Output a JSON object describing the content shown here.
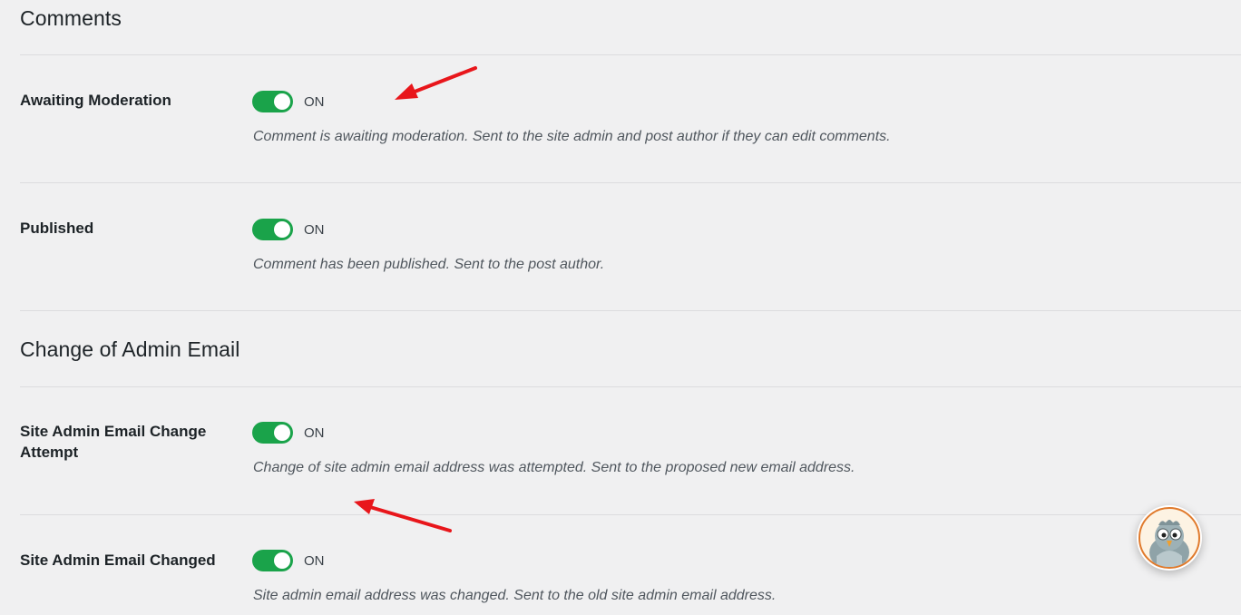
{
  "sections": [
    {
      "title": "Comments",
      "rows": [
        {
          "label": "Awaiting Moderation",
          "toggle_state": "ON",
          "description": "Comment is awaiting moderation. Sent to the site admin and post author if they can edit comments."
        },
        {
          "label": "Published",
          "toggle_state": "ON",
          "description": "Comment has been published. Sent to the post author."
        }
      ]
    },
    {
      "title": "Change of Admin Email",
      "rows": [
        {
          "label": "Site Admin Email Change Attempt",
          "toggle_state": "ON",
          "description": "Change of site admin email address was attempted. Sent to the proposed new email address."
        },
        {
          "label": "Site Admin Email Changed",
          "toggle_state": "ON",
          "description": "Site admin email address was changed. Sent to the old site admin email address."
        }
      ]
    }
  ],
  "colors": {
    "background": "#f0f0f1",
    "toggle_on": "#1aa34a",
    "annotation_arrow": "#e8161b",
    "avatar_ring": "#e07a2c"
  },
  "chat_launcher": {
    "icon": "bird-mascot-icon"
  }
}
